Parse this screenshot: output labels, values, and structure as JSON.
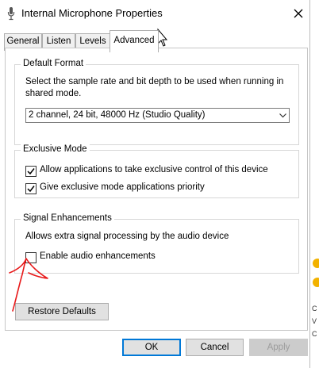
{
  "window": {
    "title": "Internal Microphone Properties",
    "close_glyph": "✕"
  },
  "tabs": [
    {
      "label": "General"
    },
    {
      "label": "Listen"
    },
    {
      "label": "Levels"
    },
    {
      "label": "Advanced",
      "selected": true
    }
  ],
  "default_format": {
    "legend": "Default Format",
    "description": "Select the sample rate and bit depth to be used when running in shared mode.",
    "selected_value": "2 channel, 24 bit, 48000 Hz (Studio Quality)"
  },
  "exclusive_mode": {
    "legend": "Exclusive Mode",
    "options": [
      {
        "label": "Allow applications to take exclusive control of this device",
        "checked": true
      },
      {
        "label": "Give exclusive mode applications priority",
        "checked": true
      }
    ]
  },
  "signal_enhancements": {
    "legend": "Signal Enhancements",
    "description": "Allows extra signal processing by the audio device",
    "option": {
      "label": "Enable audio enhancements",
      "checked": false
    }
  },
  "buttons": {
    "restore": "Restore Defaults",
    "ok": "OK",
    "cancel": "Cancel",
    "apply": "Apply"
  },
  "colors": {
    "ok_border": "#0078d7",
    "annotation": "#e8191a"
  },
  "icons": [
    "microphone-icon",
    "close-icon",
    "chevron-down-icon",
    "checkmark-icon",
    "mouse-cursor-icon"
  ]
}
